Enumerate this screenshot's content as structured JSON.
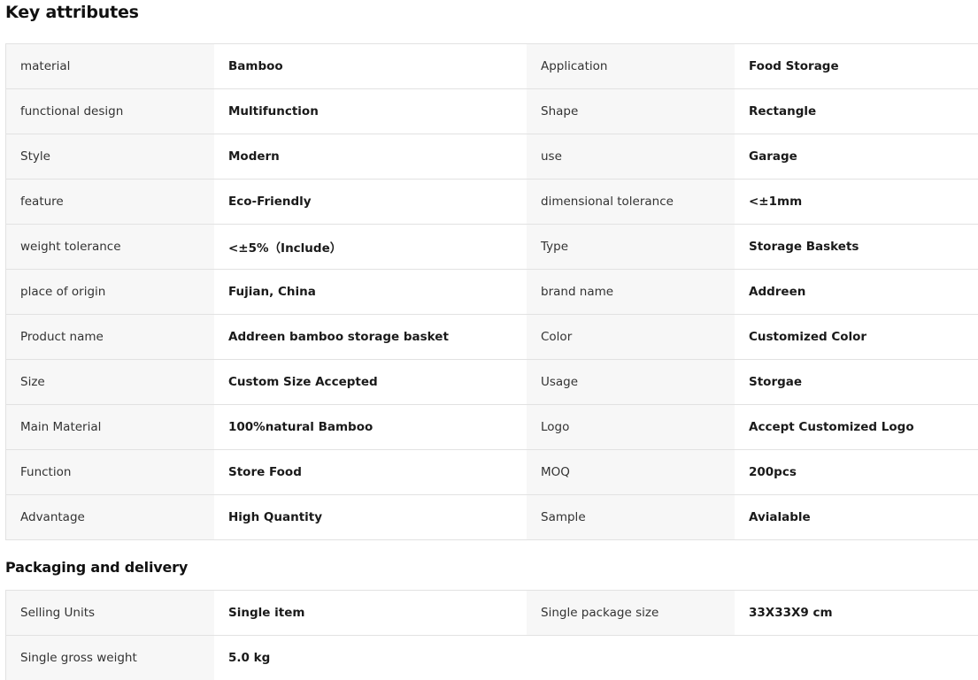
{
  "key_attributes": {
    "title": "Key attributes",
    "rows": [
      {
        "l1": "material",
        "v1": "Bamboo",
        "l2": "Application",
        "v2": "Food Storage"
      },
      {
        "l1": "functional design",
        "v1": "Multifunction",
        "l2": "Shape",
        "v2": "Rectangle"
      },
      {
        "l1": "Style",
        "v1": "Modern",
        "l2": "use",
        "v2": "Garage"
      },
      {
        "l1": "feature",
        "v1": "Eco-Friendly",
        "l2": "dimensional tolerance",
        "v2": "<±1mm"
      },
      {
        "l1": "weight tolerance",
        "v1": "<±5%（Include）",
        "l2": "Type",
        "v2": "Storage Baskets"
      },
      {
        "l1": "place of origin",
        "v1": "Fujian, China",
        "l2": "brand name",
        "v2": "Addreen"
      },
      {
        "l1": "Product name",
        "v1": "Addreen bamboo storage basket",
        "l2": "Color",
        "v2": "Customized Color"
      },
      {
        "l1": "Size",
        "v1": "Custom Size Accepted",
        "l2": "Usage",
        "v2": "Storgae"
      },
      {
        "l1": "Main Material",
        "v1": "100%natural Bamboo",
        "l2": "Logo",
        "v2": "Accept Customized Logo"
      },
      {
        "l1": "Function",
        "v1": "Store Food",
        "l2": "MOQ",
        "v2": "200pcs"
      },
      {
        "l1": "Advantage",
        "v1": "High Quantity",
        "l2": "Sample",
        "v2": "Avialable"
      }
    ]
  },
  "packaging": {
    "title": "Packaging and delivery",
    "rows": [
      {
        "l1": "Selling Units",
        "v1": "Single item",
        "l2": "Single package size",
        "v2": "33X33X9 cm"
      }
    ],
    "last_row": {
      "l1": "Single gross weight",
      "v1": "5.0 kg"
    }
  },
  "colors": {
    "label_bg": "#f7f7f7",
    "border": "#e2e2e2"
  }
}
